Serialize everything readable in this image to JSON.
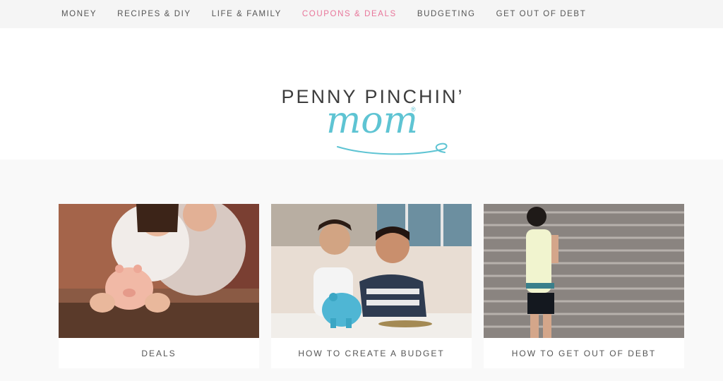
{
  "nav": {
    "items": [
      {
        "label": "MONEY"
      },
      {
        "label": "RECIPES & DIY"
      },
      {
        "label": "LIFE & FAMILY"
      },
      {
        "label": "COUPONS & DEALS"
      },
      {
        "label": "BUDGETING"
      },
      {
        "label": "GET OUT OF DEBT"
      }
    ],
    "active_index": 3,
    "active_color": "#e8769a"
  },
  "logo": {
    "line1": "PENNY PINCHIN’",
    "line2": "mom",
    "registered": "®",
    "script_color": "#5ec4d3"
  },
  "cards": [
    {
      "label": "DEALS",
      "image": "girl-and-mother-with-pink-piggy-bank-photo"
    },
    {
      "label": "HOW TO CREATE A BUDGET",
      "image": "girl-and-mother-with-blue-piggy-bank-photo"
    },
    {
      "label": "HOW TO GET OUT OF DEBT",
      "image": "woman-running-up-stairs-photo"
    }
  ]
}
